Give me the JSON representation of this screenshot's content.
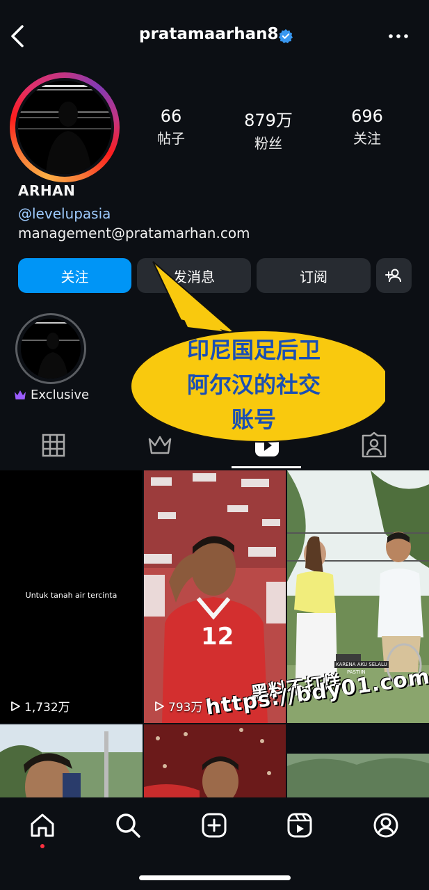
{
  "header": {
    "title": "pratamaarhan8"
  },
  "stats": [
    {
      "num": "66",
      "label": "帖子"
    },
    {
      "num": "879万",
      "label": "粉丝"
    },
    {
      "num": "696",
      "label": "关注"
    }
  ],
  "profile": {
    "name": "ARHAN",
    "handle": "@levelupasia",
    "email": "management@pratamarhan.com"
  },
  "actions": {
    "follow": "关注",
    "message": "发消息",
    "subscribe": "订阅"
  },
  "highlight": {
    "label": "Exclusive"
  },
  "callout": {
    "line1": "印尼国足后卫",
    "line2": "阿尔汉的社交",
    "line3": "账号"
  },
  "grid": {
    "post1_caption": "Untuk tanah air tercinta",
    "post1_views": "1,732万",
    "post2_views": "793万",
    "post3_caption_a": "KARENA AKU SELALU",
    "post3_caption_b": "PASTIIN"
  },
  "watermark": {
    "line1": "黑料不打烊",
    "line2": "https://bdy01.com"
  },
  "colors": {
    "accent": "#0095f6",
    "verified": "#3897f0",
    "highlight_crown": "#9b5cff"
  }
}
